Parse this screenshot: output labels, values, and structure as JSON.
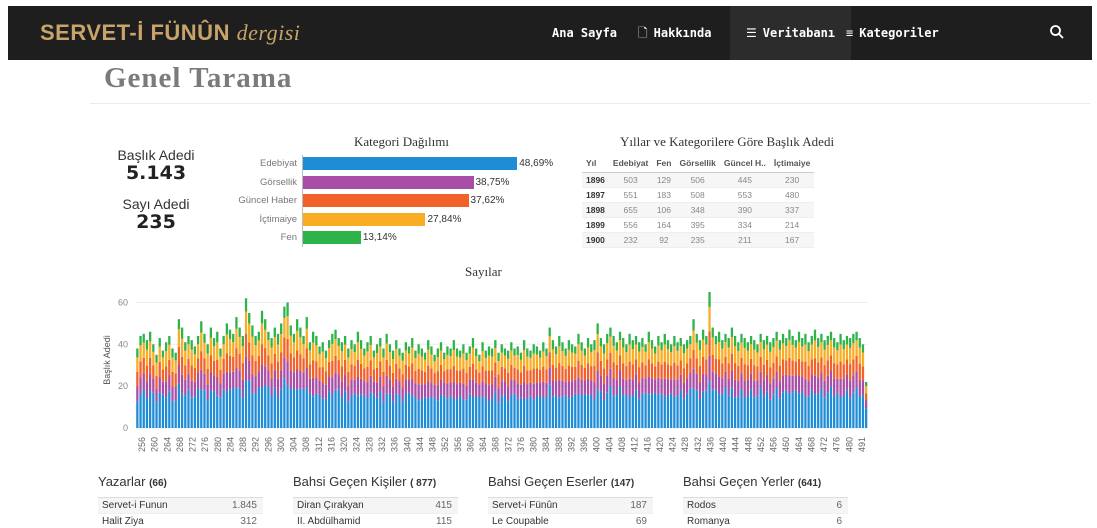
{
  "header": {
    "brand_main": "SERVET-İ FÜNÛN",
    "brand_sub": "dergisi",
    "nav": [
      {
        "label": "Ana Sayfa",
        "icon": ""
      },
      {
        "label": "Hakkında",
        "icon": "document-icon"
      },
      {
        "label": "Veritabanı",
        "icon": "database-icon"
      },
      {
        "label": "Kategoriler",
        "icon": "list-icon"
      }
    ],
    "active_nav": "Veritabanı",
    "icons": {
      "search": "search-icon"
    }
  },
  "page": {
    "title": "Genel Tarama"
  },
  "kpis": {
    "baslik_label": "Başlık Adedi",
    "baslik_value": "5.143",
    "sayi_label": "Sayı Adedi",
    "sayi_value": "235"
  },
  "kategori": {
    "title": "Kategori Dağılımı"
  },
  "yillar": {
    "title": "Yıllar ve Kategorilere Göre Başlık Adedi",
    "columns": [
      "Yıl",
      "Edebiyat",
      "Fen",
      "Görsellik",
      "Güncel H..",
      "İçtimaiye"
    ],
    "rows": [
      [
        "1896",
        "503",
        "129",
        "506",
        "445",
        "230"
      ],
      [
        "1897",
        "551",
        "183",
        "508",
        "553",
        "480"
      ],
      [
        "1898",
        "655",
        "106",
        "348",
        "390",
        "337"
      ],
      [
        "1899",
        "556",
        "164",
        "395",
        "334",
        "214"
      ],
      [
        "1900",
        "232",
        "92",
        "235",
        "211",
        "167"
      ]
    ]
  },
  "colors": {
    "edebiyat": "#1f8dd6",
    "gorsellik": "#a94ea6",
    "guncel": "#f2612a",
    "ictimaiye": "#f9ad25",
    "fen": "#2eb34b"
  },
  "chart_data": [
    {
      "type": "bar",
      "title": "Kategori Dağılımı",
      "categories": [
        "Edebiyat",
        "Görsellik",
        "Güncel Haber",
        "İçtimaiye",
        "Fen"
      ],
      "values": [
        48.69,
        38.75,
        37.62,
        27.84,
        13.14
      ],
      "value_labels": [
        "48,69%",
        "38,75%",
        "37,62%",
        "27,84%",
        "13,14%"
      ],
      "orientation": "horizontal",
      "xlim": [
        0,
        50
      ]
    },
    {
      "type": "bar",
      "title": "Sayılar",
      "ylabel": "Başlık Adedi",
      "ylim": [
        0,
        65
      ],
      "yticks": [
        0,
        20,
        40,
        60
      ],
      "stacked": true,
      "x_start": 255,
      "x_end": 492,
      "tick_labels": [
        "256",
        "260",
        "264",
        "268",
        "272",
        "276",
        "280",
        "284",
        "288",
        "292",
        "296",
        "300",
        "304",
        "308",
        "312",
        "316",
        "320",
        "324",
        "328",
        "332",
        "336",
        "340",
        "344",
        "348",
        "352",
        "356",
        "360",
        "364",
        "368",
        "372",
        "376",
        "380",
        "384",
        "388",
        "392",
        "396",
        "400",
        "404",
        "408",
        "412",
        "416",
        "420",
        "424",
        "428",
        "432",
        "436",
        "440",
        "444",
        "448",
        "452",
        "456",
        "460",
        "464",
        "468",
        "472",
        "476",
        "480",
        "491"
      ],
      "series_order": [
        "Edebiyat",
        "Görsellik",
        "Güncel Haber",
        "İçtimaiye",
        "Fen"
      ],
      "totals_sample": [
        38,
        44,
        45,
        42,
        46,
        40,
        35,
        43,
        37,
        41,
        44,
        38,
        36,
        52,
        48,
        41,
        44,
        42,
        39,
        44,
        51,
        45,
        40,
        48,
        43,
        46,
        38,
        44,
        50,
        47,
        45,
        53,
        48,
        44,
        62,
        55,
        49,
        44,
        46,
        56,
        52,
        46,
        43,
        48,
        45,
        50,
        58,
        60,
        49,
        45,
        52,
        48,
        44,
        53,
        41,
        46,
        44,
        39,
        41,
        37,
        42,
        45,
        47,
        43,
        41,
        44,
        38,
        42,
        40,
        46,
        42,
        38,
        41,
        44,
        37,
        40,
        43,
        38,
        45,
        40,
        37,
        42,
        38,
        36,
        41,
        39,
        43,
        37,
        40,
        38,
        36,
        42,
        39,
        35,
        38,
        41,
        36,
        39,
        38,
        42,
        38,
        37,
        40,
        36,
        39,
        43,
        38,
        35,
        41,
        37,
        39,
        38,
        42,
        36,
        40,
        38,
        37,
        41,
        38,
        39,
        36,
        42,
        38,
        37,
        40,
        39,
        37,
        41,
        38,
        48,
        42,
        39,
        44,
        41,
        38,
        42,
        40,
        39,
        45,
        41,
        38,
        43,
        40,
        42,
        50,
        43,
        40,
        45,
        48,
        44,
        41,
        46,
        43,
        40,
        45,
        42,
        44,
        41,
        43,
        40,
        46,
        42,
        39,
        44,
        41,
        45,
        42,
        40,
        44,
        41,
        43,
        40,
        42,
        44,
        52,
        45,
        42,
        47,
        44,
        65,
        48,
        44,
        46,
        42,
        45,
        43,
        48,
        44,
        41,
        45,
        43,
        41,
        44,
        42,
        40,
        45,
        42,
        44,
        41,
        43,
        46,
        42,
        45,
        43,
        47,
        44,
        42,
        46,
        43,
        45,
        41,
        44,
        47,
        43,
        45,
        42,
        44,
        46,
        43,
        41,
        45,
        42,
        44,
        43,
        45,
        46,
        43,
        40,
        22
      ]
    }
  ],
  "panels": [
    {
      "title": "Yazarlar",
      "count": "(66)",
      "rows": [
        [
          "Servet-i Funun",
          "1.845"
        ],
        [
          "Halit Ziya",
          "312"
        ]
      ]
    },
    {
      "title": "Bahsi Geçen Kişiler",
      "count": "( 877)",
      "rows": [
        [
          "Diran Çırakyan",
          "415"
        ],
        [
          "II. Abdülhamid",
          "115"
        ]
      ]
    },
    {
      "title": "Bahsi Geçen Eserler",
      "count": "(147)",
      "rows": [
        [
          "Servet-i Fünûn",
          "187"
        ],
        [
          "Le Coupable",
          "69"
        ]
      ]
    },
    {
      "title": "Bahsi Geçen Yerler",
      "count": "(641)",
      "rows": [
        [
          "Rodos",
          "6"
        ],
        [
          "Romanya",
          "6"
        ]
      ]
    }
  ]
}
